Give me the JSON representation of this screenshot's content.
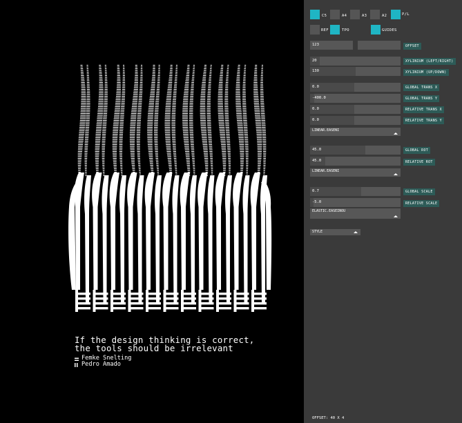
{
  "artwork": {
    "quote_line1": "If the design thinking is correct,",
    "quote_line2": "the tools should be irrelevant",
    "author1": "Femke Snelting",
    "author2": "Pedro Amado"
  },
  "panel": {
    "formats": [
      {
        "label": "C5",
        "active": true
      },
      {
        "label": "A4",
        "active": false
      },
      {
        "label": "A3",
        "active": false
      },
      {
        "label": "A2",
        "active": false
      },
      {
        "label": "P/L",
        "active": true
      }
    ],
    "options": [
      {
        "label": "REF",
        "active": false
      },
      {
        "label": "TPO",
        "active": true
      },
      {
        "label": "GUIDES",
        "active": true
      }
    ],
    "offset": {
      "value": "123",
      "label": "OFFSET"
    },
    "xylinium": {
      "value": "20",
      "label": "XYLINIUM  (LEFT/RIGHT)"
    },
    "ylinium": {
      "value": "130",
      "label": "XYLINIUM  (UP/DOWN)"
    },
    "global_trans_x": {
      "value": "0.0",
      "label": "GLOBAL TRANS X"
    },
    "global_trans_y": {
      "value": "-400.0",
      "label": "GLOBAL TRANS Y"
    },
    "relative_trans_x": {
      "value": "0.0",
      "label": "RELATIVE TRANS X"
    },
    "relative_trans_y": {
      "value": "0.0",
      "label": "RELATIVE TRANS Y"
    },
    "easing1": "LINEAR.EASENI",
    "global_rot": {
      "value": "45.0",
      "label": "GLOBAL ROT"
    },
    "relative_rot": {
      "value": "45.0",
      "label": "RELATIVE ROT"
    },
    "easing2": "LINEAR.EASENI",
    "global_scale": {
      "value": "0.7",
      "label": "GLOBAL SCALE"
    },
    "relative_scale": {
      "value": "-5.0",
      "label": "RELATIVE SCALE"
    },
    "easing3": "ELASTIC.EASEINOU",
    "style": "STYLE",
    "footer": "OFFSET: 40 X 4"
  },
  "colors": {
    "accent": "#1fb5c4",
    "tag": "#2d5b57",
    "panel": "#3a3a3a",
    "field": "#575757"
  }
}
